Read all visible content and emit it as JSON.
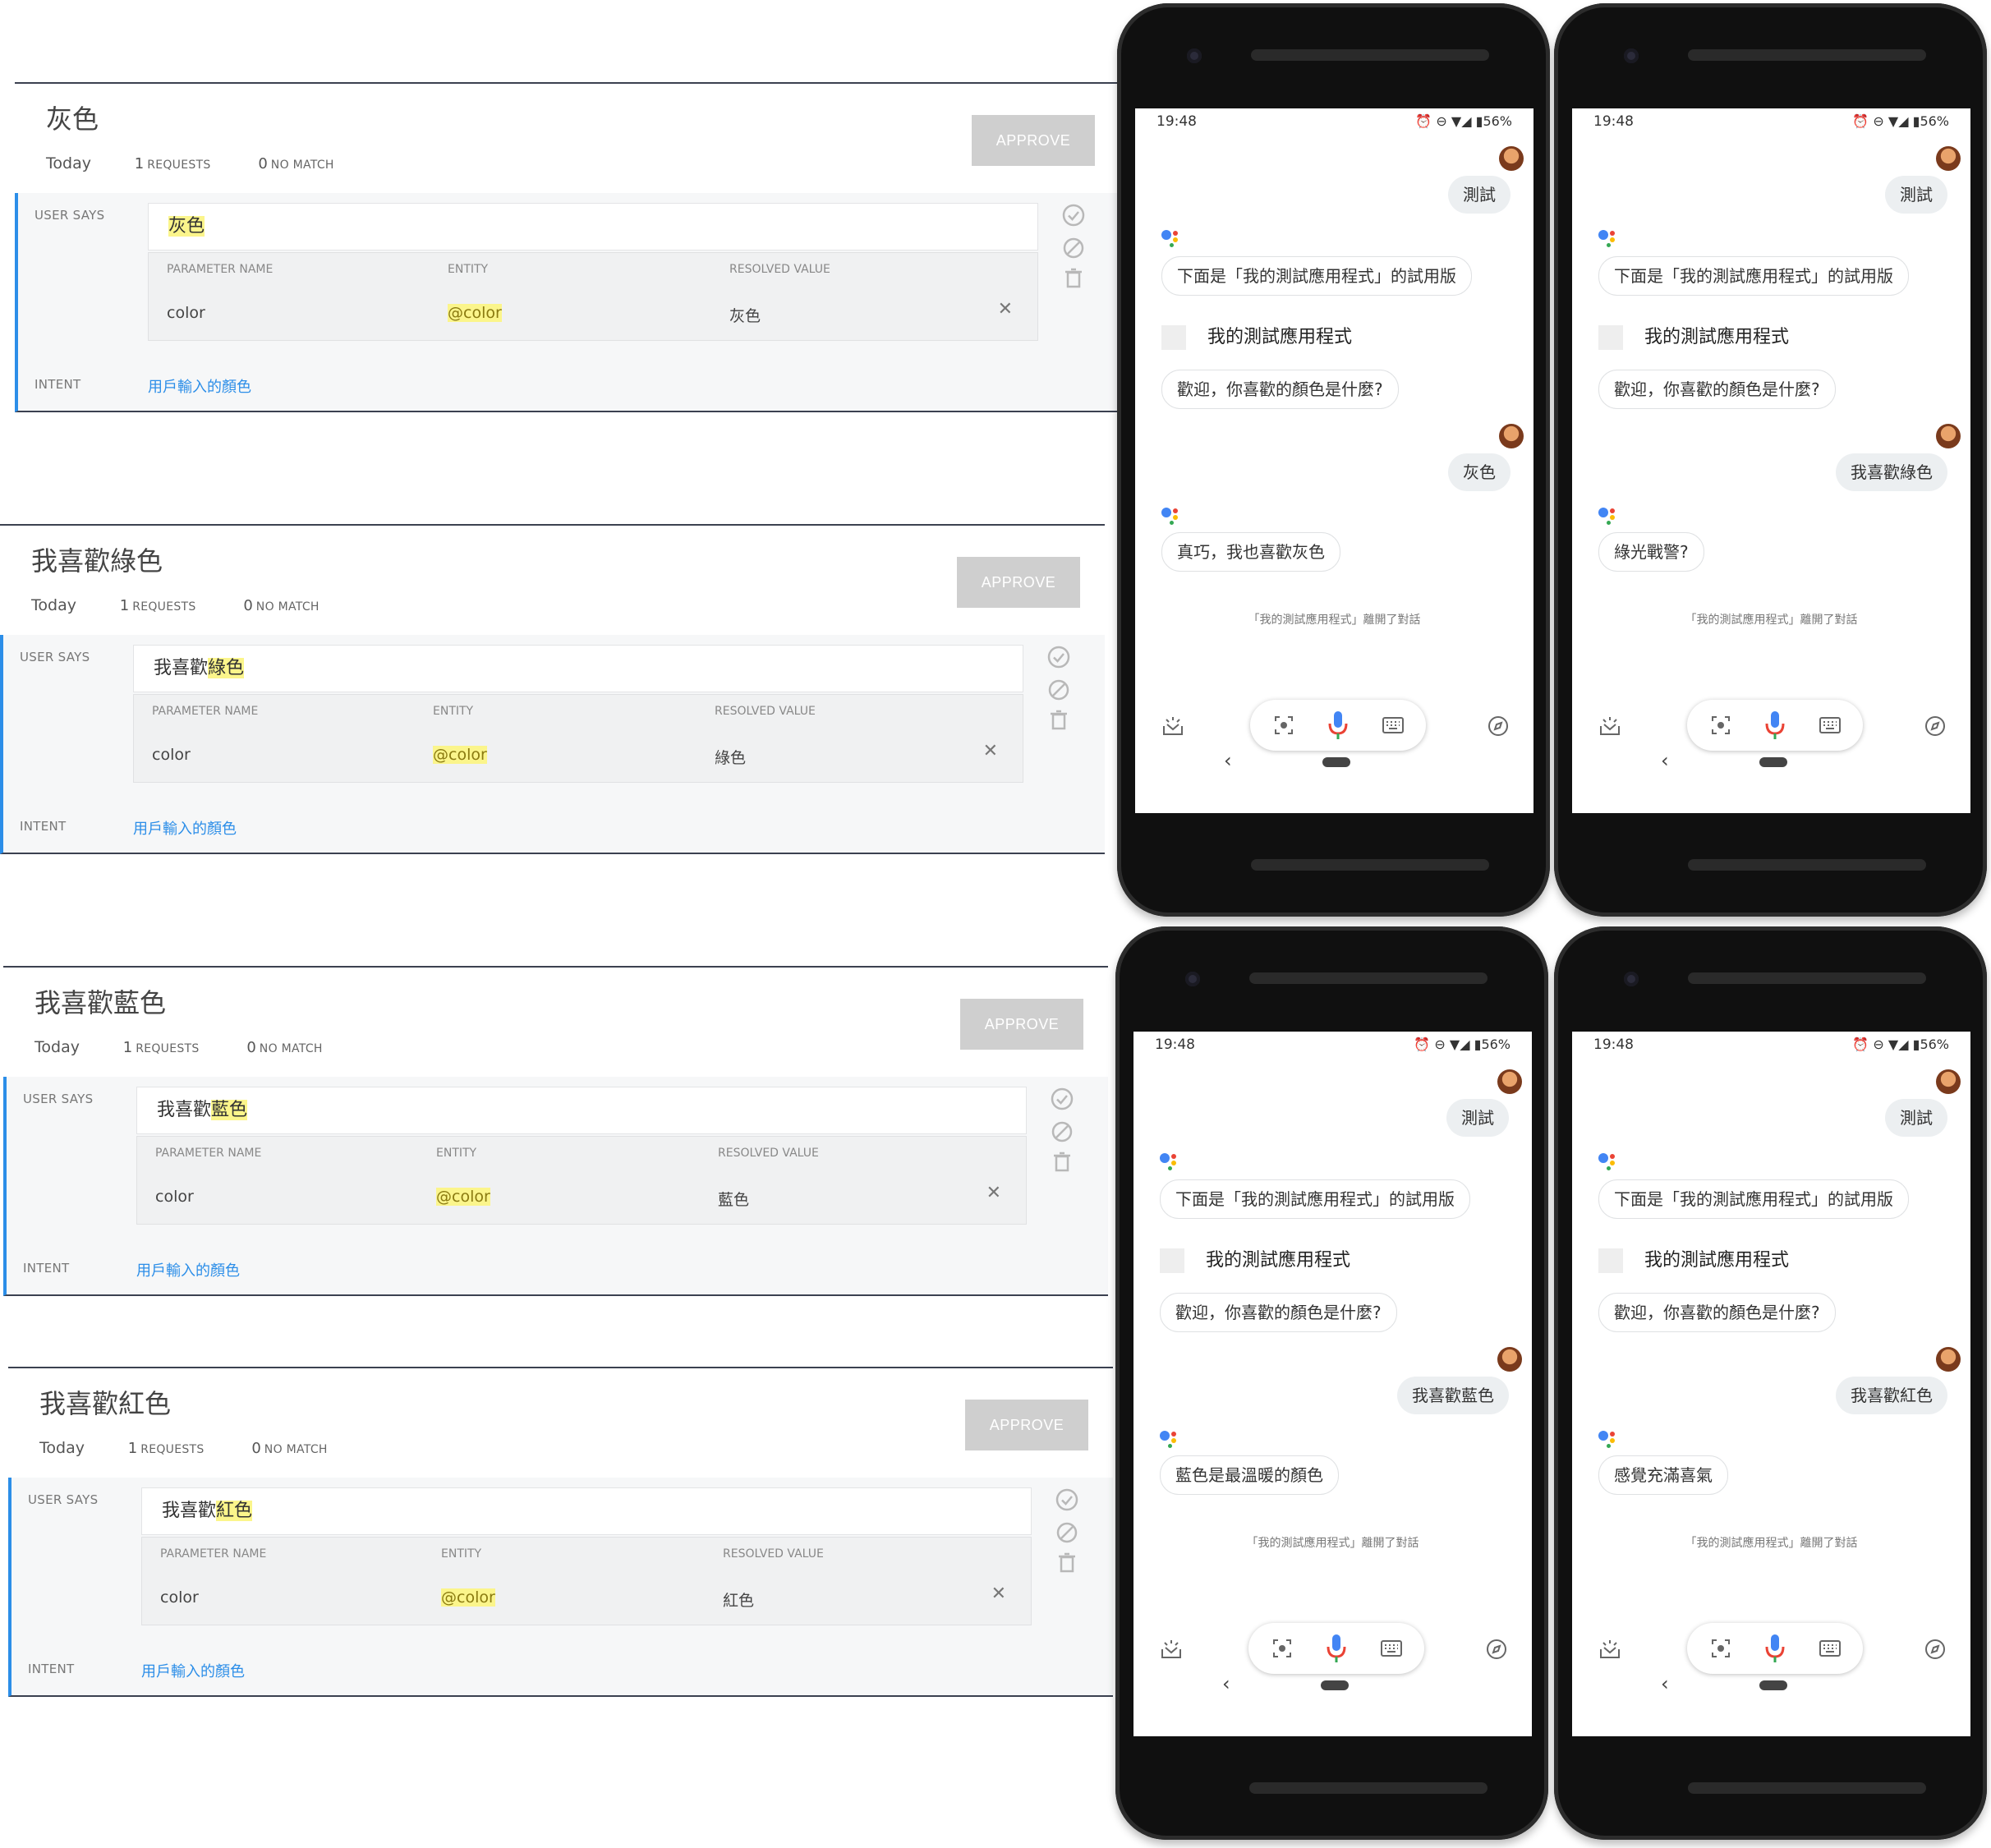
{
  "cards": [
    {
      "title": "灰色",
      "date": "Today",
      "requests_count": "1",
      "requests_label": "REQUESTS",
      "nomatch_count": "0",
      "nomatch_label": "NO MATCH",
      "approve": "APPROVE",
      "user_says_label": "USER SAYS",
      "says_prefix": "",
      "says_highlight": "灰色",
      "param_header": "PARAMETER NAME",
      "entity_header": "ENTITY",
      "resolved_header": "RESOLVED VALUE",
      "param_name": "color",
      "entity": "@color",
      "resolved": "灰色",
      "intent_label": "INTENT",
      "intent": "用戶輸入的顏色"
    },
    {
      "title": "我喜歡綠色",
      "date": "Today",
      "requests_count": "1",
      "requests_label": "REQUESTS",
      "nomatch_count": "0",
      "nomatch_label": "NO MATCH",
      "approve": "APPROVE",
      "user_says_label": "USER SAYS",
      "says_prefix": "我喜歡",
      "says_highlight": "綠色",
      "param_header": "PARAMETER NAME",
      "entity_header": "ENTITY",
      "resolved_header": "RESOLVED VALUE",
      "param_name": "color",
      "entity": "@color",
      "resolved": "綠色",
      "intent_label": "INTENT",
      "intent": "用戶輸入的顏色"
    },
    {
      "title": "我喜歡藍色",
      "date": "Today",
      "requests_count": "1",
      "requests_label": "REQUESTS",
      "nomatch_count": "0",
      "nomatch_label": "NO MATCH",
      "approve": "APPROVE",
      "user_says_label": "USER SAYS",
      "says_prefix": "我喜歡",
      "says_highlight": "藍色",
      "param_header": "PARAMETER NAME",
      "entity_header": "ENTITY",
      "resolved_header": "RESOLVED VALUE",
      "param_name": "color",
      "entity": "@color",
      "resolved": "藍色",
      "intent_label": "INTENT",
      "intent": "用戶輸入的顏色"
    },
    {
      "title": "我喜歡紅色",
      "date": "Today",
      "requests_count": "1",
      "requests_label": "REQUESTS",
      "nomatch_count": "0",
      "nomatch_label": "NO MATCH",
      "approve": "APPROVE",
      "user_says_label": "USER SAYS",
      "says_prefix": "我喜歡",
      "says_highlight": "紅色",
      "param_header": "PARAMETER NAME",
      "entity_header": "ENTITY",
      "resolved_header": "RESOLVED VALUE",
      "param_name": "color",
      "entity": "@color",
      "resolved": "紅色",
      "intent_label": "INTENT",
      "intent": "用戶輸入的顏色"
    }
  ],
  "phones": [
    {
      "time": "19:48",
      "battery": "56%",
      "user_msg1": "測試",
      "assistant_msg1": "下面是「我的測試應用程式」的試用版",
      "app_name": "我的測試應用程式",
      "assistant_msg2": "歡迎，你喜歡的顏色是什麼?",
      "user_msg2": "灰色",
      "assistant_msg3": "真巧，我也喜歡灰色",
      "left_note": "「我的測試應用程式」離開了對話"
    },
    {
      "time": "19:48",
      "battery": "56%",
      "user_msg1": "測試",
      "assistant_msg1": "下面是「我的測試應用程式」的試用版",
      "app_name": "我的測試應用程式",
      "assistant_msg2": "歡迎，你喜歡的顏色是什麼?",
      "user_msg2": "我喜歡綠色",
      "assistant_msg3": "綠光戰警?",
      "left_note": "「我的測試應用程式」離開了對話"
    },
    {
      "time": "19:48",
      "battery": "56%",
      "user_msg1": "測試",
      "assistant_msg1": "下面是「我的測試應用程式」的試用版",
      "app_name": "我的測試應用程式",
      "assistant_msg2": "歡迎，你喜歡的顏色是什麼?",
      "user_msg2": "我喜歡藍色",
      "assistant_msg3": "藍色是最溫暖的顏色",
      "left_note": "「我的測試應用程式」離開了對話"
    },
    {
      "time": "19:48",
      "battery": "56%",
      "user_msg1": "測試",
      "assistant_msg1": "下面是「我的測試應用程式」的試用版",
      "app_name": "我的測試應用程式",
      "assistant_msg2": "歡迎，你喜歡的顏色是什麼?",
      "user_msg2": "我喜歡紅色",
      "assistant_msg3": "感覺充滿喜氣",
      "left_note": "「我的測試應用程式」離開了對話"
    }
  ],
  "colors": {
    "accent_blue": "#2c8ee8",
    "highlight_yellow": "#fbf58b",
    "approve_gray": "#cfcfcf",
    "google_blue": "#4285f4",
    "google_red": "#ea4335",
    "google_yellow": "#fbbc05",
    "google_green": "#34a853"
  },
  "icons": [
    "check-circle-icon",
    "block-icon",
    "trash-icon",
    "close-icon",
    "google-assistant-icon",
    "lens-icon",
    "mic-icon",
    "keyboard-icon",
    "compass-icon",
    "snapshot-icon",
    "alarm-icon",
    "dnd-icon",
    "wifi-icon",
    "signal-icon",
    "battery-icon"
  ]
}
